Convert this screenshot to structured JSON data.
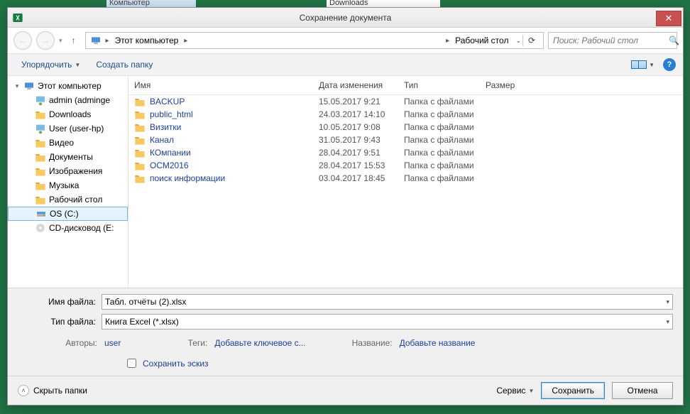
{
  "bg": {
    "hint1": "Компьютер",
    "hint2": "Downloads"
  },
  "dialog": {
    "title": "Сохранение документа"
  },
  "breadcrumb": {
    "root": "Этот компьютер",
    "current": "Рабочий стол"
  },
  "search": {
    "placeholder": "Поиск: Рабочий стол"
  },
  "toolbar": {
    "organize": "Упорядочить",
    "new_folder": "Создать папку"
  },
  "tree": {
    "items": [
      {
        "label": "Этот компьютер",
        "indent": 0,
        "expanded": true,
        "icon": "pc"
      },
      {
        "label": "admin (adminge",
        "indent": 1,
        "icon": "netfolder"
      },
      {
        "label": "Downloads",
        "indent": 1,
        "icon": "folder"
      },
      {
        "label": "User (user-hp)",
        "indent": 1,
        "icon": "netfolder"
      },
      {
        "label": "Видео",
        "indent": 1,
        "icon": "folder"
      },
      {
        "label": "Документы",
        "indent": 1,
        "icon": "folder"
      },
      {
        "label": "Изображения",
        "indent": 1,
        "icon": "folder"
      },
      {
        "label": "Музыка",
        "indent": 1,
        "icon": "folder"
      },
      {
        "label": "Рабочий стол",
        "indent": 1,
        "icon": "folder"
      },
      {
        "label": "OS (C:)",
        "indent": 1,
        "icon": "drive",
        "selected": true
      },
      {
        "label": "CD-дисковод (E:",
        "indent": 1,
        "icon": "cd"
      }
    ]
  },
  "list": {
    "columns": {
      "name": "Имя",
      "date": "Дата изменения",
      "type": "Тип",
      "size": "Размер"
    },
    "rows": [
      {
        "name": "BACKUP",
        "date": "15.05.2017 9:21",
        "type": "Папка с файлами"
      },
      {
        "name": "public_html",
        "date": "24.03.2017 14:10",
        "type": "Папка с файлами"
      },
      {
        "name": "Визитки",
        "date": "10.05.2017 9:08",
        "type": "Папка с файлами"
      },
      {
        "name": "Канал",
        "date": "31.05.2017 9:43",
        "type": "Папка с файлами"
      },
      {
        "name": "КОмпании",
        "date": "28.04.2017 9:51",
        "type": "Папка с файлами"
      },
      {
        "name": "ОСМ2016",
        "date": "28.04.2017 15:53",
        "type": "Папка с файлами"
      },
      {
        "name": "поиск информации",
        "date": "03.04.2017 18:45",
        "type": "Папка с файлами"
      }
    ]
  },
  "fields": {
    "filename_label": "Имя файла:",
    "filename_value": "Табл. отчёты (2).xlsx",
    "filetype_label": "Тип файла:",
    "filetype_value": "Книга Excel (*.xlsx)"
  },
  "meta": {
    "authors_label": "Авторы:",
    "authors_value": "user",
    "tags_label": "Теги:",
    "tags_value": "Добавьте ключевое с...",
    "title_label": "Название:",
    "title_value": "Добавьте название",
    "thumb_label": "Сохранить эскиз"
  },
  "footer": {
    "hide_folders": "Скрыть папки",
    "service": "Сервис",
    "save": "Сохранить",
    "cancel": "Отмена"
  }
}
